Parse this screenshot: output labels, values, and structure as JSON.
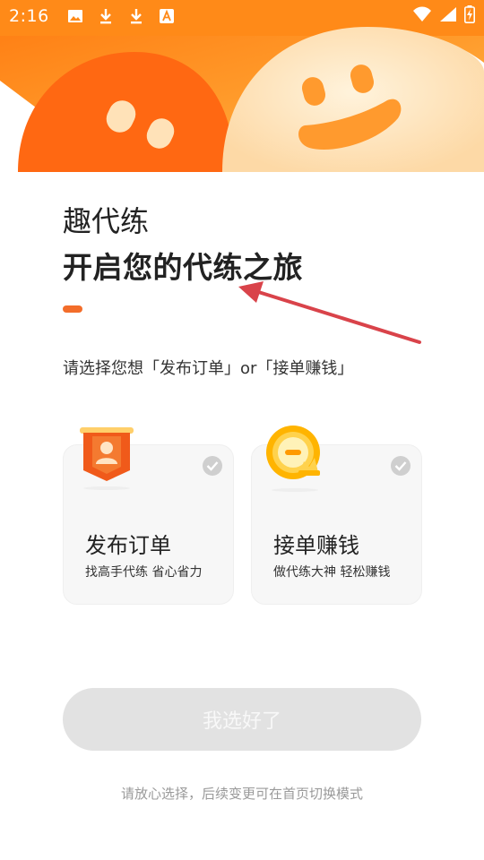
{
  "status_bar": {
    "time": "2:16",
    "icons": [
      "image-icon",
      "download-icon",
      "download-icon",
      "font-icon"
    ],
    "right_icons": [
      "wifi-icon",
      "signal-icon",
      "battery-icon"
    ]
  },
  "hero": {
    "colors": {
      "background": "#ff8c1a",
      "left_blob": "#ff6a12",
      "right_blob": "#fde2b8",
      "eyes": "#ffe0b0",
      "mouth": "#ff9a2e"
    }
  },
  "app_name": "趣代练",
  "headline": "开启您的代练之旅",
  "instruction": "请选择您想「发布订单」or「接单赚钱」",
  "options": [
    {
      "title": "发布订单",
      "subtitle": "找高手代练 省心省力",
      "icon": "user-badge-icon",
      "selected": false
    },
    {
      "title": "接单赚钱",
      "subtitle": "做代练大神 轻松赚钱",
      "icon": "coin-badge-icon",
      "selected": false
    }
  ],
  "confirm_label": "我选好了",
  "footnote": "请放心选择，后续变更可在首页切换模式",
  "accent_color": "#f36d2a"
}
